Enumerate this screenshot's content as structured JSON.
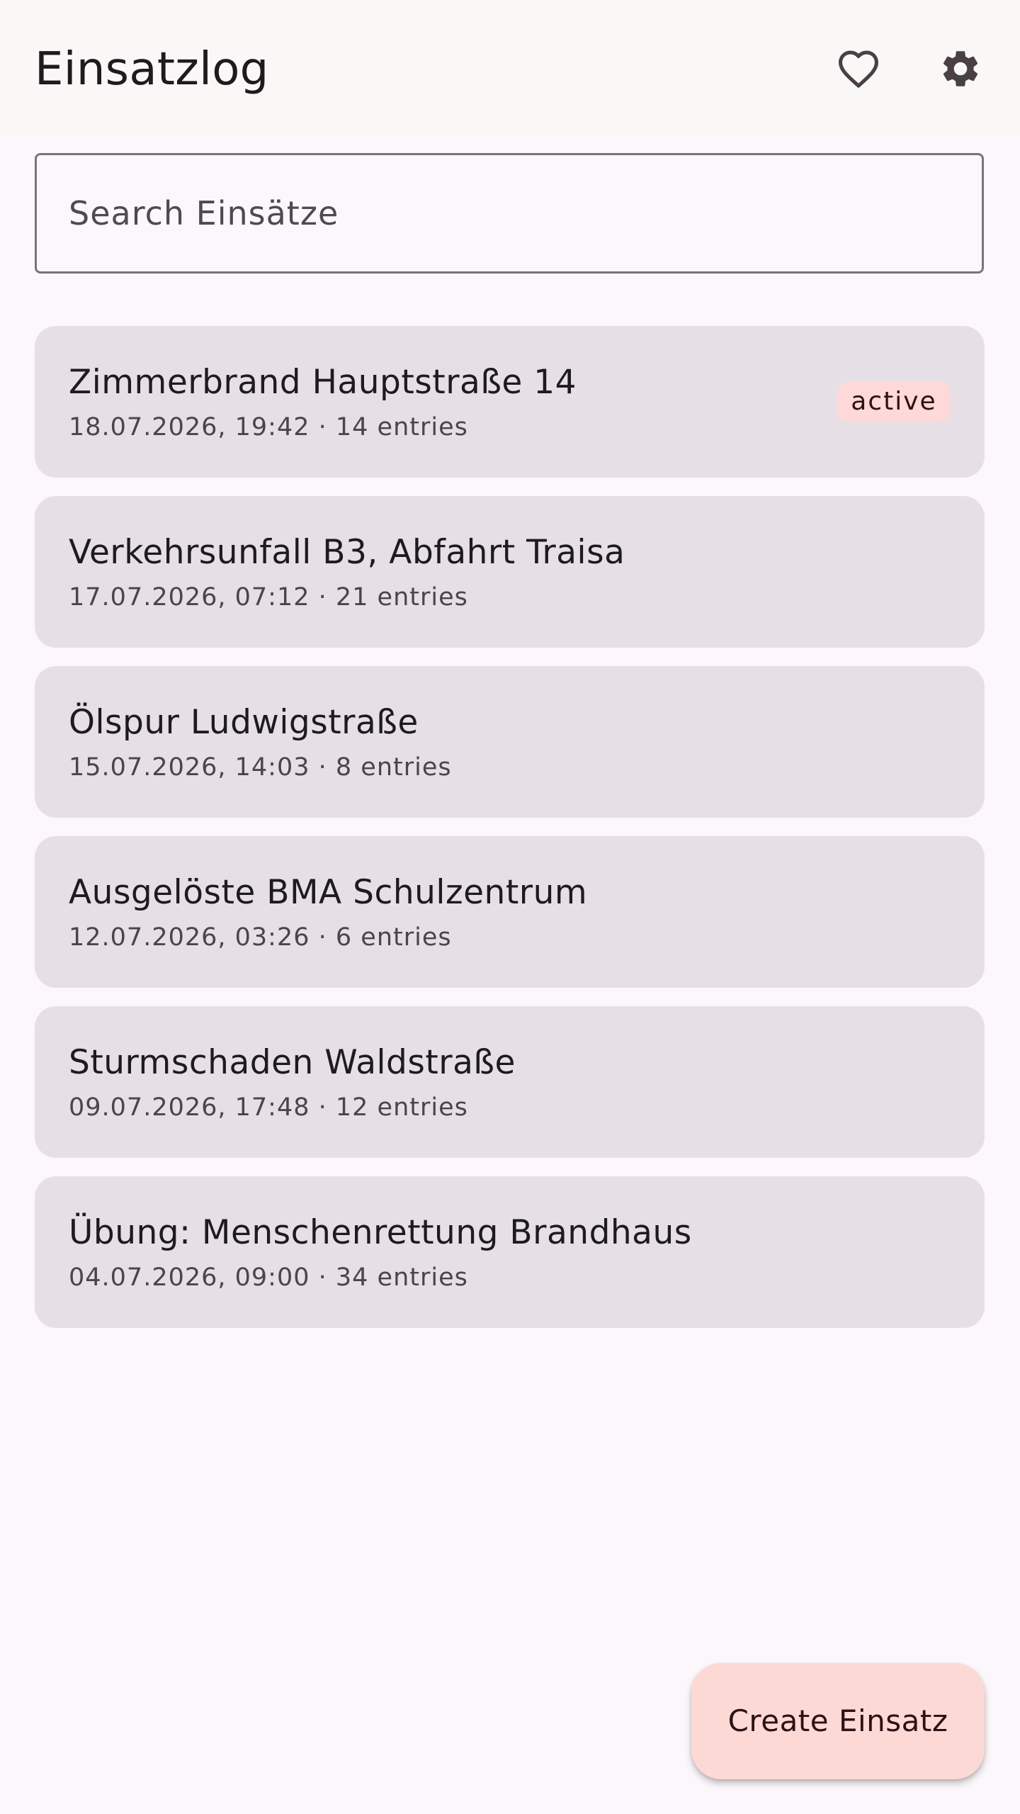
{
  "app_bar": {
    "title": "Einsatzlog",
    "favorites_icon": "heart-outline-icon",
    "settings_icon": "gear-icon"
  },
  "search": {
    "placeholder": "Search Einsätze",
    "value": ""
  },
  "incidents": [
    {
      "title": "Zimmerbrand Hauptstraße 14",
      "subtitle": "18.07.2026, 19:42 · 14 entries",
      "badge": "active"
    },
    {
      "title": "Verkehrsunfall B3, Abfahrt Traisa",
      "subtitle": "17.07.2026, 07:12 · 21 entries"
    },
    {
      "title": "Ölspur Ludwigstraße",
      "subtitle": "15.07.2026, 14:03 · 8 entries"
    },
    {
      "title": "Ausgelöste BMA Schulzentrum",
      "subtitle": "12.07.2026, 03:26 · 6 entries"
    },
    {
      "title": "Sturmschaden Waldstraße",
      "subtitle": "09.07.2026, 17:48 · 12 entries"
    },
    {
      "title": "Übung: Menschenrettung Brandhaus",
      "subtitle": "04.07.2026, 09:00 · 34 entries"
    }
  ],
  "fab": {
    "label": "Create Einsatz"
  },
  "colors": {
    "background": "#fcf7fb",
    "app_bar": "#faf7f7",
    "card": "#e6e0e6",
    "badge": "#fed9d8",
    "fab": "#fdd9d6",
    "icon": "#4a3f43"
  }
}
